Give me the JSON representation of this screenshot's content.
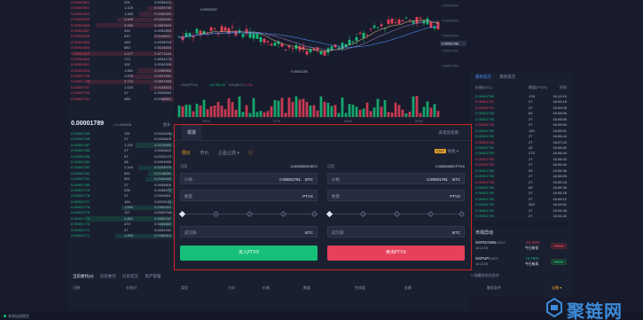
{
  "orderbook": {
    "asks": [
      {
        "price": "0.00001812",
        "amount": "201",
        "total": "0.0036421"
      },
      {
        "price": "0.00001811",
        "amount": "1,125",
        "total": "0.0203738"
      },
      {
        "price": "0.00001810",
        "amount": "1,450",
        "total": "0.0262450"
      },
      {
        "price": "0.00001809",
        "amount": "2,400",
        "total": "0.0434160"
      },
      {
        "price": "0.00001808",
        "amount": "3,250",
        "total": "0.0587600"
      },
      {
        "price": "0.00001807",
        "amount": "290",
        "total": "0.0052403"
      },
      {
        "price": "0.00001806",
        "amount": "812",
        "total": "0.0146647"
      },
      {
        "price": "0.00001805",
        "amount": "159",
        "total": "0.0028700"
      },
      {
        "price": "0.00001804",
        "amount": "682",
        "total": "0.0123033"
      },
      {
        "price": "0.00001803",
        "amount": "4,277",
        "total": "0.0771143"
      },
      {
        "price": "0.00001802",
        "amount": "173",
        "total": "0.0031175"
      },
      {
        "price": "0.00001801",
        "amount": "191",
        "total": "0.0034399"
      },
      {
        "price": "0.00001800",
        "amount": "1,561",
        "total": "0.0280980"
      },
      {
        "price": "0.00001799",
        "amount": "1,876",
        "total": "0.0337492"
      },
      {
        "price": "0.00001798",
        "amount": "3,710",
        "total": "0.0667058"
      },
      {
        "price": "0.00001797",
        "amount": "1,023",
        "total": "0.0183833"
      },
      {
        "price": "0.00001796",
        "amount": "27",
        "total": "0.0004849"
      },
      {
        "price": "0.00001791",
        "amount": "485",
        "total": "0.0086864"
      }
    ],
    "last_price": "0.00001789",
    "last_cny": "≈ 0.000806",
    "more_label": "更多",
    "bids": [
      {
        "price": "0.00001789",
        "amount": "131",
        "total": "0.0023436"
      },
      {
        "price": "0.00001788",
        "amount": "27",
        "total": "0.0004828"
      },
      {
        "price": "0.00001787",
        "amount": "1,231",
        "total": "0.0219980"
      },
      {
        "price": "0.00001786",
        "amount": "27",
        "total": "0.0004822"
      },
      {
        "price": "0.00001785",
        "amount": "57",
        "total": "0.0010175"
      },
      {
        "price": "0.00001784",
        "amount": "28",
        "total": "0.0004995"
      },
      {
        "price": "0.00001783",
        "amount": "1,144",
        "total": "0.0203975"
      },
      {
        "price": "0.00001782",
        "amount": "831",
        "total": "0.0148084"
      },
      {
        "price": "0.00001781",
        "amount": "901",
        "total": "0.0160468"
      },
      {
        "price": "0.00001780",
        "amount": "27",
        "total": "0.0004806"
      },
      {
        "price": "0.00001779",
        "amount": "205",
        "total": "0.0036470"
      },
      {
        "price": "0.00001778",
        "amount": "27",
        "total": "0.0004801"
      },
      {
        "price": "0.00001777",
        "amount": "164",
        "total": "0.0029143"
      },
      {
        "price": "0.00001776",
        "amount": "1,691",
        "total": "0.0300322"
      },
      {
        "price": "0.00001775",
        "amount": "117",
        "total": "0.0020768"
      },
      {
        "price": "0.00001774",
        "amount": "2,851",
        "total": "0.0505767"
      },
      {
        "price": "0.00001773",
        "amount": "473",
        "total": "0.0083863"
      },
      {
        "price": "0.00001772",
        "amount": "27",
        "total": "0.0004784"
      },
      {
        "price": "0.00001771",
        "amount": "1,899",
        "total": "0.0336313"
      }
    ]
  },
  "chart": {
    "high_label": "0.00002537",
    "low_label": "0.00001250",
    "current_price": "0.00001789",
    "vol_legend": "VOL(PTVX)",
    "vol_value": "147,593.40",
    "vol_btc_legend": "VOL(BTC)",
    "vol_btc_value": "2.741",
    "y_ticks": [
      "0.00002900",
      "0.00002500",
      "0.00002100",
      "0.00001700",
      "0.00001300"
    ],
    "x_ticks": [
      "08/03",
      "07/01",
      "08/08",
      "08/09"
    ],
    "colors": {
      "up": "#16be78",
      "down": "#e6405a",
      "ma1": "#c4aa7a",
      "ma2": "#8f79b8",
      "ma3": "#4d8cf5"
    }
  },
  "trades": {
    "tabs": [
      "最新成交",
      "我的成交"
    ],
    "headers": [
      "价格(BTC)",
      "数量(PTVX)",
      "时间"
    ],
    "rows": [
      {
        "side": "buy",
        "price": "0.00001789",
        "amount": "178",
        "time": "16:13:10"
      },
      {
        "side": "sell",
        "price": "0.00001791",
        "amount": "27",
        "time": "16:09:15"
      },
      {
        "side": "sell",
        "price": "0.00001791",
        "amount": "27",
        "time": "16:09:06"
      },
      {
        "side": "buy",
        "price": "0.00001794",
        "amount": "60",
        "time": "16:08:56"
      },
      {
        "side": "buy",
        "price": "0.00001793",
        "amount": "27",
        "time": "16:08:55"
      },
      {
        "side": "sell",
        "price": "0.00001793",
        "amount": "27",
        "time": "16:08:54"
      },
      {
        "side": "buy",
        "price": "0.00001792",
        "amount": "152",
        "time": "16:08:51"
      },
      {
        "side": "buy",
        "price": "0.00001792",
        "amount": "27",
        "time": "16:08:44"
      },
      {
        "side": "sell",
        "price": "0.00001794",
        "amount": "27",
        "time": "16:07:02"
      },
      {
        "side": "buy",
        "price": "0.00001791",
        "amount": "42",
        "time": "16:06:55"
      },
      {
        "side": "buy",
        "price": "0.00001792",
        "amount": "273",
        "time": "16:06:49"
      },
      {
        "side": "sell",
        "price": "0.00001790",
        "amount": "27",
        "time": "16:06:42"
      },
      {
        "side": "sell",
        "price": "0.00001790",
        "amount": "27",
        "time": "16:06:40"
      },
      {
        "side": "buy",
        "price": "0.00001789",
        "amount": "93",
        "time": "16:06:36"
      },
      {
        "side": "buy",
        "price": "0.00001790",
        "amount": "27",
        "time": "16:05:55"
      },
      {
        "side": "sell",
        "price": "0.00001790",
        "amount": "27",
        "time": "16:05:43"
      },
      {
        "side": "buy",
        "price": "0.00001790",
        "amount": "63",
        "time": "16:05:36"
      },
      {
        "side": "buy",
        "price": "0.00001790",
        "amount": "27",
        "time": "16:05:28"
      },
      {
        "side": "buy",
        "price": "0.00001791",
        "amount": "27",
        "time": "16:05:12"
      },
      {
        "side": "buy",
        "price": "0.00001792",
        "amount": "200",
        "time": "16:04:51"
      },
      {
        "side": "buy",
        "price": "0.00001792",
        "amount": "27",
        "time": "16:04:45"
      },
      {
        "side": "buy",
        "price": "0.00001791",
        "amount": "27",
        "time": "16:04:42"
      }
    ]
  },
  "movers": {
    "title": "市场异动",
    "items": [
      {
        "symbol": "SXPDOWN",
        "quote": "/USDT",
        "time": "16:12:08",
        "change": "-10.25%",
        "label": "今日新低",
        "dir": "down"
      },
      {
        "symbol": "SXPUP",
        "quote": "/USDT",
        "time": "16:12:08",
        "change": "+4.75%",
        "label": "今日新高",
        "dir": "up"
      }
    ]
  },
  "form": {
    "tab": "现货",
    "guide_link": "去现货指南",
    "order_types": [
      "限价",
      "市价",
      "止盈止损 ▾",
      "ⓘ"
    ],
    "fee_badge": "CNY",
    "fee_label": "免税 ▾",
    "buy": {
      "avail_label": "可用",
      "avail_value": "0.00000000 BTC",
      "price_label": "价格",
      "price_value": "0.00001791",
      "price_unit": "BTC",
      "qty_label": "数量",
      "qty_unit": "PTVX",
      "total_label": "成交额",
      "total_unit": "BTC",
      "button": "买入PTVX"
    },
    "sell": {
      "avail_label": "可用",
      "avail_value": "0.00000000 PTVX",
      "price_label": "价格",
      "price_value": "0.00001791",
      "price_unit": "BTC",
      "qty_label": "数量",
      "qty_unit": "PTVX",
      "total_label": "成交额",
      "total_unit": "BTC",
      "button": "卖出PTVX"
    }
  },
  "orders": {
    "tabs": [
      "当前委托(0)",
      "历史委托",
      "历史成交",
      "资产管理"
    ],
    "headers": [
      "日期",
      "交易对",
      "类型",
      "方向",
      "价格",
      "数量",
      "完成度",
      "金额",
      "触发条件"
    ],
    "hide_other": "隐藏其他交易对",
    "all_label": "全撤 ▾"
  },
  "status": {
    "text": "系统连接稳定"
  },
  "watermark": {
    "text": "聚链网"
  }
}
